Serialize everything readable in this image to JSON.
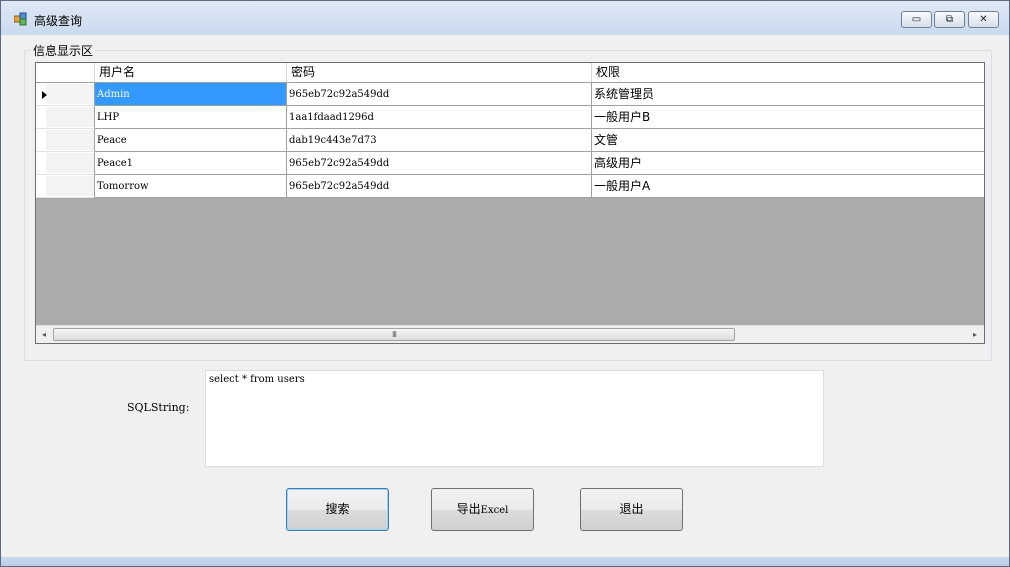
{
  "window": {
    "title": "高级查询",
    "controls": {
      "minimize": "▭",
      "restore": "⧉",
      "close": "✕"
    }
  },
  "group": {
    "label": "信息显示区"
  },
  "grid": {
    "columns": [
      "用户名",
      "密码",
      "权限"
    ],
    "rows": [
      {
        "username": "Admin",
        "password": "965eb72c92a549dd",
        "role": "系统管理员",
        "selected": true
      },
      {
        "username": "LHP",
        "password": "1aa1fdaad1296d",
        "role": "一般用户B"
      },
      {
        "username": "Peace",
        "password": "dab19c443e7d73",
        "role": "文管"
      },
      {
        "username": "Peace1",
        "password": "965eb72c92a549dd",
        "role": "高级用户"
      },
      {
        "username": "Tomorrow",
        "password": "965eb72c92a549dd",
        "role": "一般用户A"
      }
    ],
    "scrollbar": {
      "left_arrow": "◂",
      "right_arrow": "▸",
      "grip": "III"
    }
  },
  "sql": {
    "label": "SQLString:",
    "value": "select * from users"
  },
  "buttons": {
    "search": "搜索",
    "export_prefix": "导出",
    "export_suffix": "Excel",
    "exit": "退出"
  },
  "colors": {
    "selection": "#3399ff",
    "grid_background": "#ababab",
    "window_frame": "#c9daef"
  },
  "icons": [
    "app-icon",
    "minimize-icon",
    "restore-icon",
    "close-icon",
    "row-selector-arrow-icon",
    "scroll-left-icon",
    "scroll-right-icon"
  ]
}
